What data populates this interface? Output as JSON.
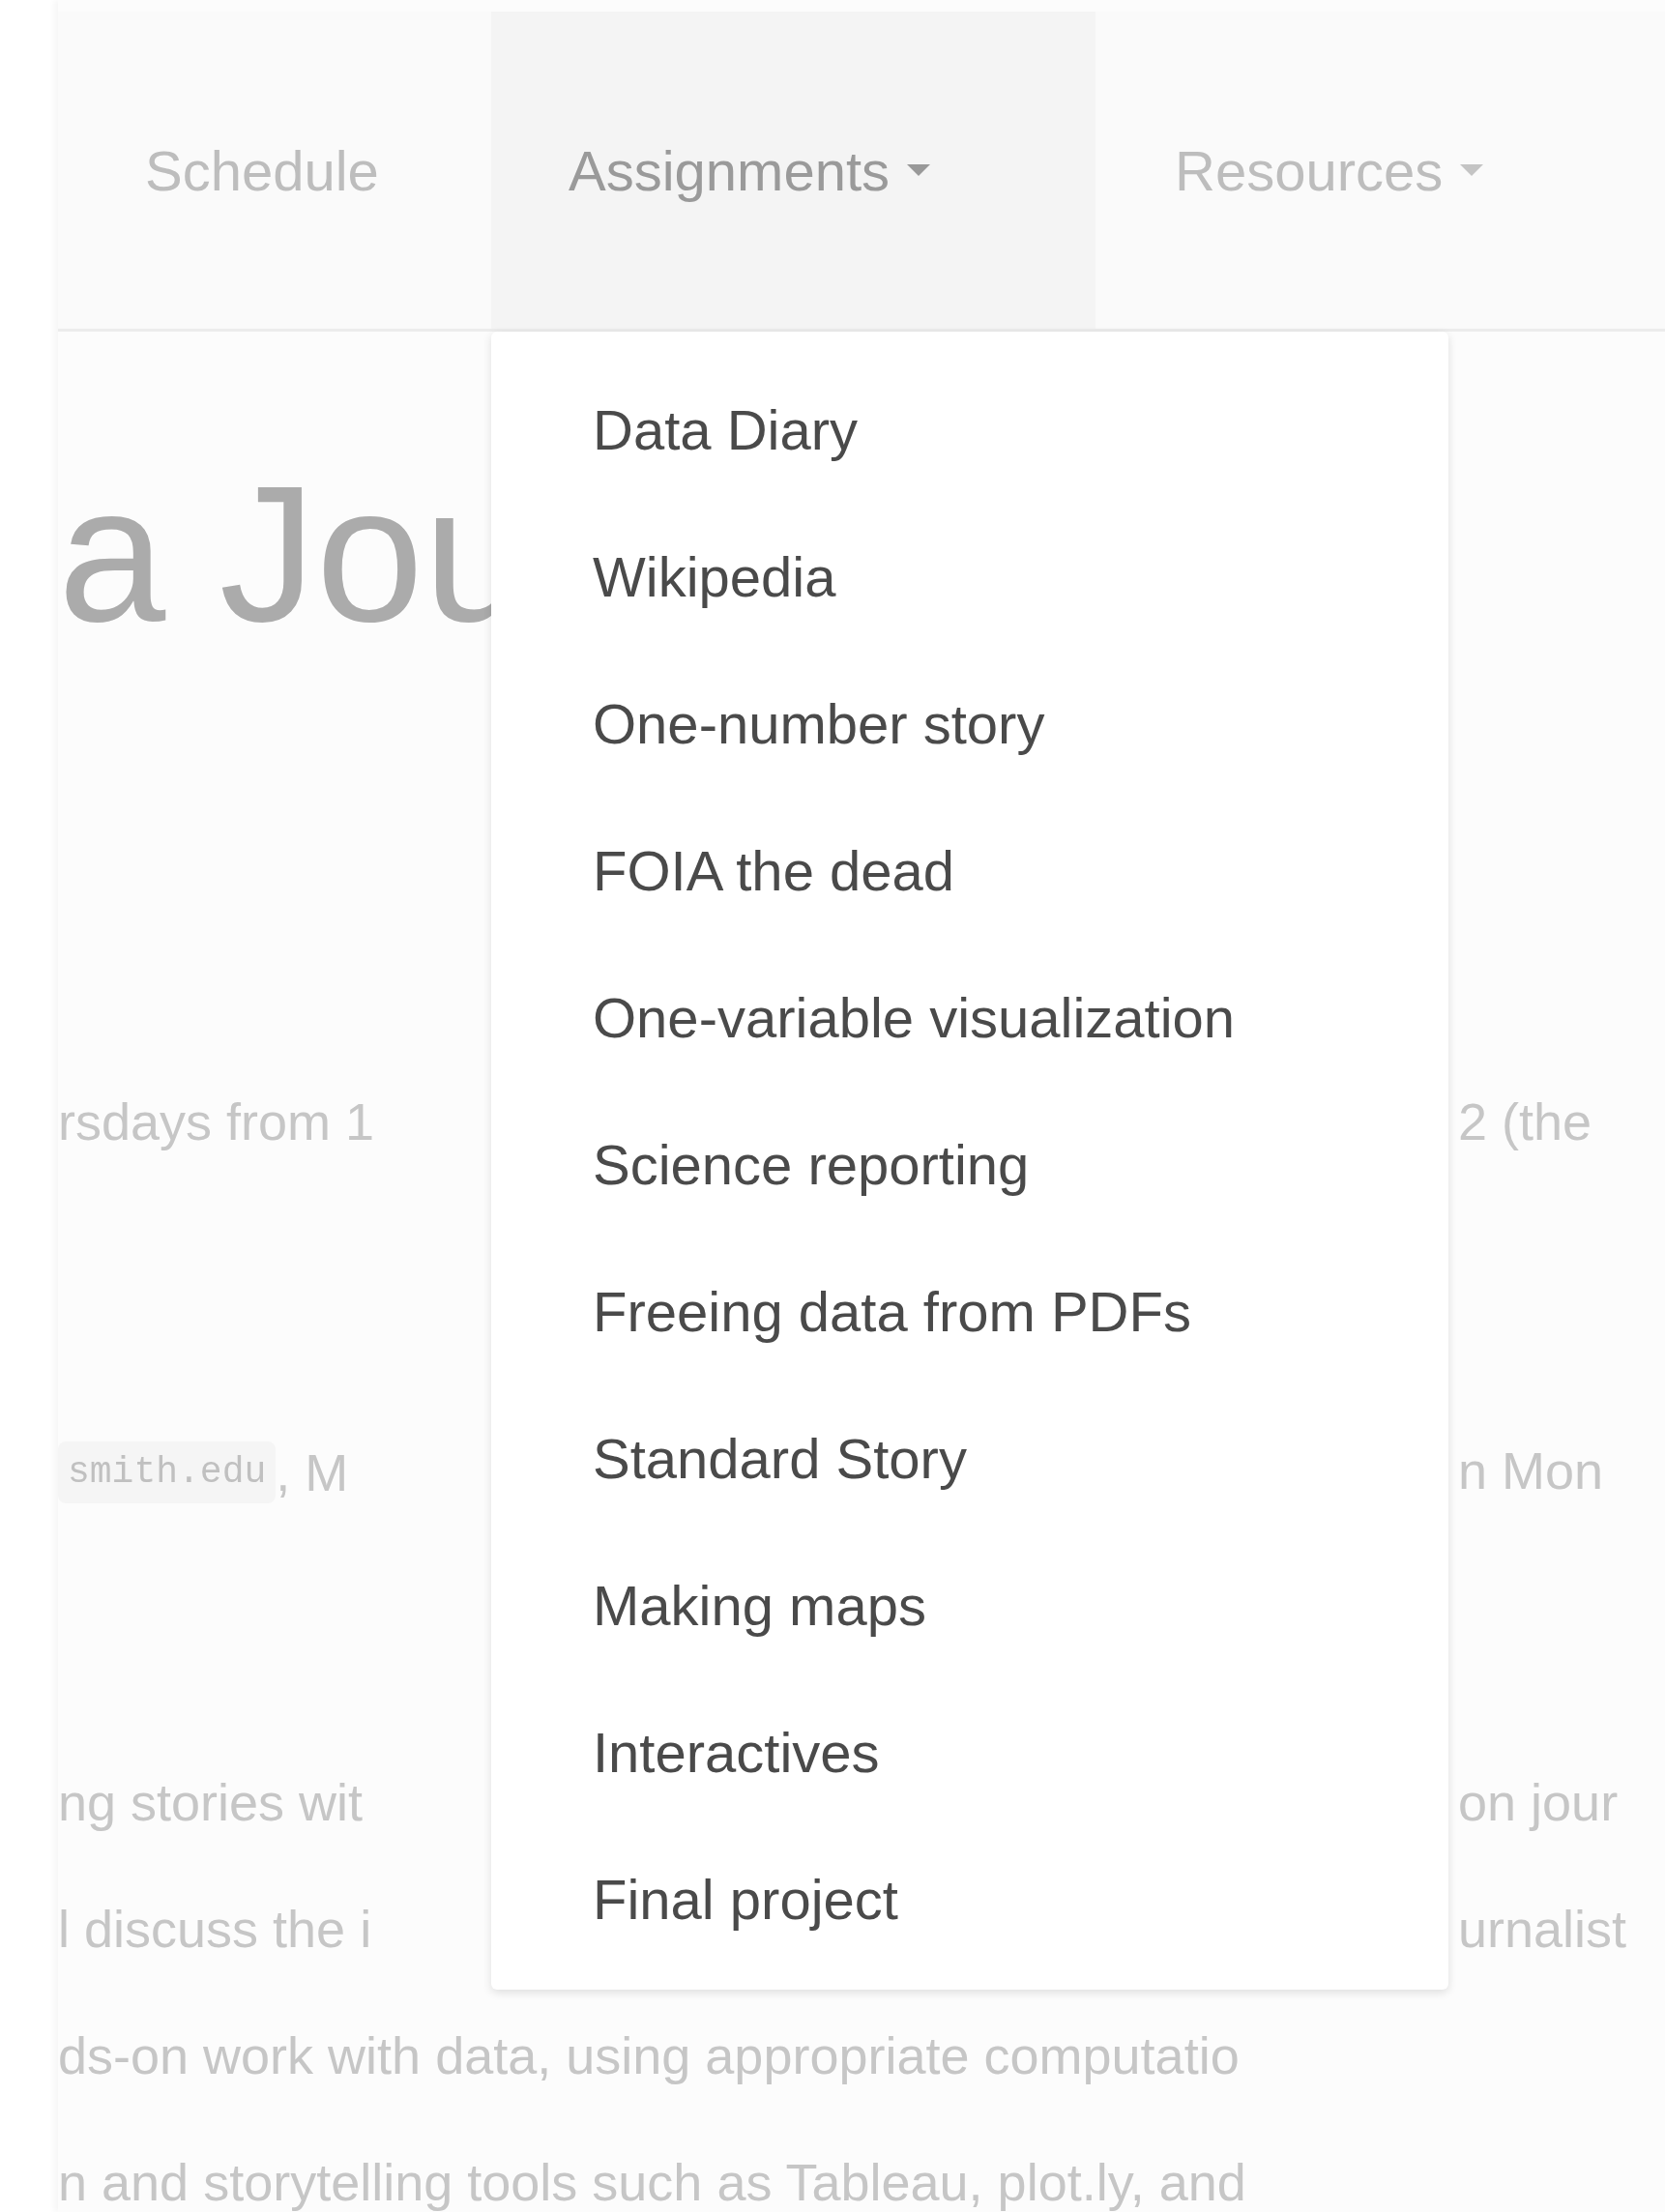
{
  "nav": {
    "tabs": [
      {
        "label": "Schedule",
        "selected": false,
        "kind": "link"
      },
      {
        "label": "Assignments",
        "selected": true,
        "kind": "dropdown"
      },
      {
        "label": "Resources",
        "selected": false,
        "kind": "dropdown"
      }
    ]
  },
  "dropdown": {
    "items": [
      "Data Diary",
      "Wikipedia",
      "One-number story",
      "FOIA the dead",
      "One-variable visualization",
      "Science reporting",
      "Freeing data from PDFs",
      "Standard Story",
      "Making maps",
      "Interactives",
      "Final project"
    ]
  },
  "page": {
    "title": "a Jou",
    "meeting": {
      "left": "rsdays from 1",
      "right": "2 (the"
    },
    "contact": {
      "code": "smith.edu",
      "left": ", M",
      "right": "n Mon"
    },
    "paragraph": [
      {
        "left": "ng stories wit",
        "right": "on jour"
      },
      {
        "left": "l discuss the i",
        "right": "urnalist"
      },
      {
        "left": "ds-on work with data, using appropriate computatio"
      },
      {
        "left": "n and storytelling tools such as Tableau, plot.ly, and"
      }
    ]
  }
}
